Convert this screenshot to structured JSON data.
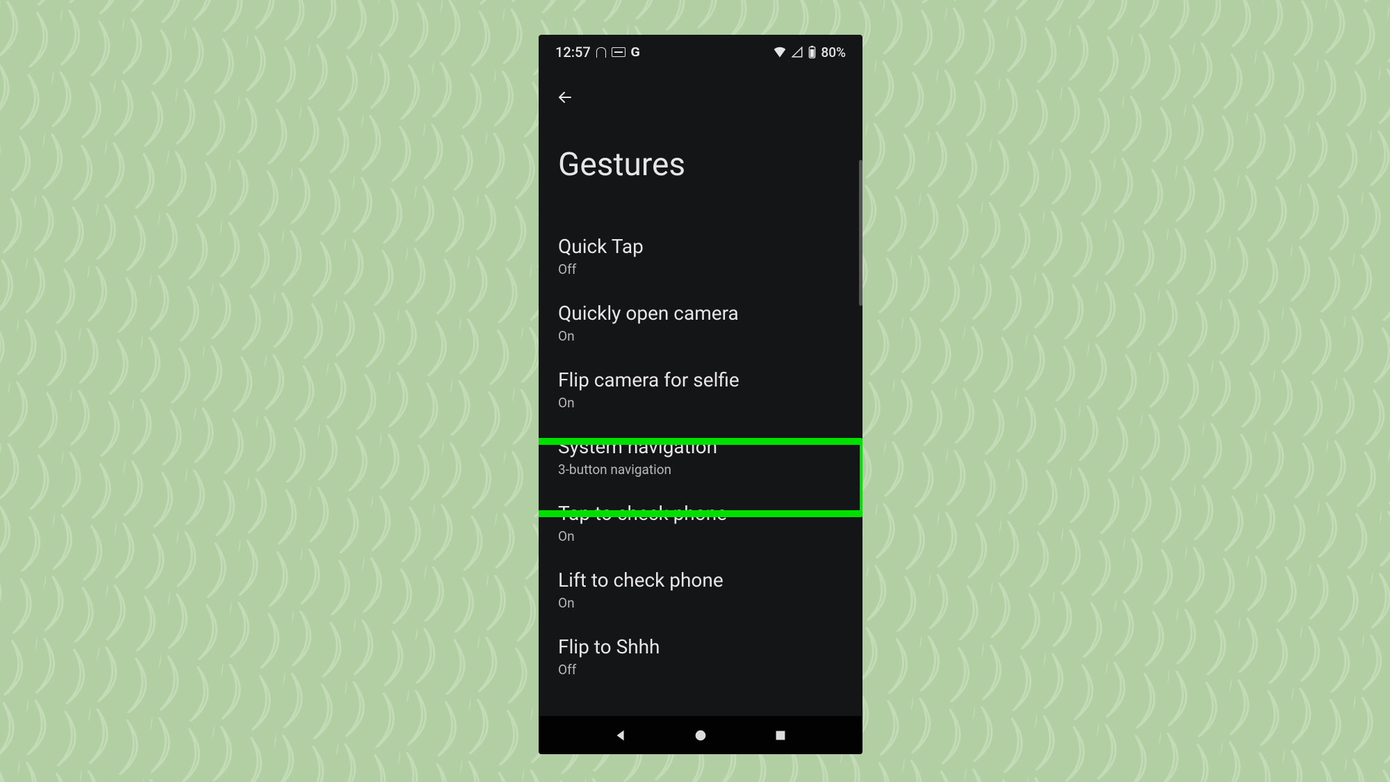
{
  "statusbar": {
    "time": "12:57",
    "battery_text": "80%"
  },
  "header": {
    "title": "Gestures"
  },
  "items": [
    {
      "title": "Quick Tap",
      "sub": "Off"
    },
    {
      "title": "Quickly open camera",
      "sub": "On"
    },
    {
      "title": "Flip camera for selfie",
      "sub": "On"
    },
    {
      "title": "System navigation",
      "sub": "3-button navigation"
    },
    {
      "title": "Tap to check phone",
      "sub": "On"
    },
    {
      "title": "Lift to check phone",
      "sub": "On"
    },
    {
      "title": "Flip to Shhh",
      "sub": "Off"
    }
  ],
  "highlight_index": 3
}
